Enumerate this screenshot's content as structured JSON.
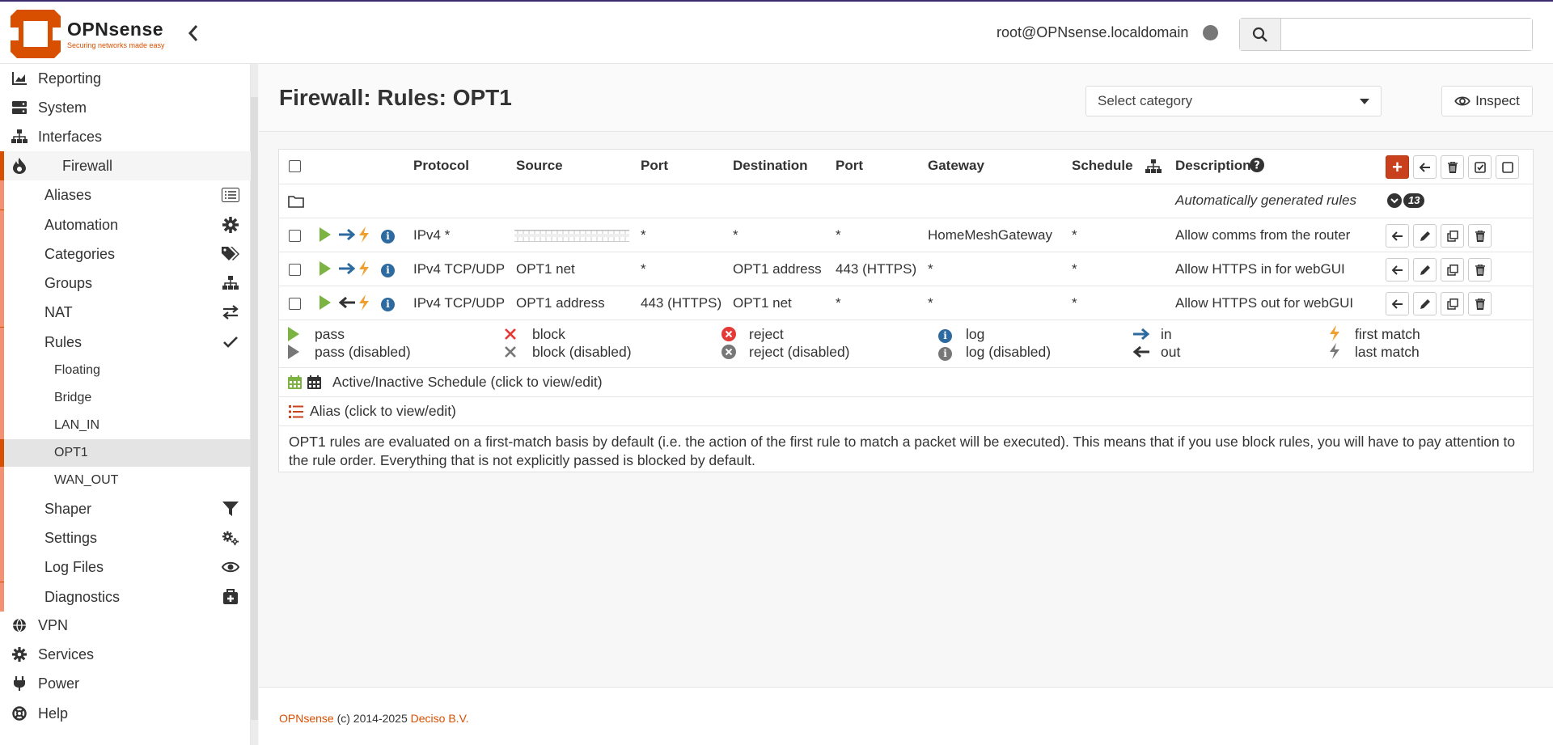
{
  "brand": {
    "name": "OPNsense",
    "tagline": "Securing networks made easy",
    "accent": "#d94f00"
  },
  "header": {
    "user": "root@OPNsense.localdomain",
    "search_placeholder": ""
  },
  "sidebar": {
    "top_items": [
      {
        "label": "Reporting",
        "icon": "chart-icon"
      },
      {
        "label": "System",
        "icon": "server-icon"
      },
      {
        "label": "Interfaces",
        "icon": "network-icon"
      },
      {
        "label": "Firewall",
        "icon": "fire-icon"
      }
    ],
    "firewall_items": [
      {
        "label": "Aliases",
        "icon": "list-icon"
      },
      {
        "label": "Automation",
        "icon": "gear-icon"
      },
      {
        "label": "Categories",
        "icon": "tags-icon"
      },
      {
        "label": "Groups",
        "icon": "sitemap-icon"
      },
      {
        "label": "NAT",
        "icon": "exchange-icon"
      },
      {
        "label": "Rules",
        "icon": "check-icon"
      }
    ],
    "rules_items": [
      "Floating",
      "Bridge",
      "LAN_IN",
      "OPT1",
      "WAN_OUT"
    ],
    "firewall_items_after": [
      {
        "label": "Shaper",
        "icon": "filter-icon"
      },
      {
        "label": "Settings",
        "icon": "gears-icon"
      },
      {
        "label": "Log Files",
        "icon": "eye-icon"
      },
      {
        "label": "Diagnostics",
        "icon": "medkit-icon"
      }
    ],
    "bottom_items": [
      {
        "label": "VPN",
        "icon": "globe-icon"
      },
      {
        "label": "Services",
        "icon": "cog-icon"
      },
      {
        "label": "Power",
        "icon": "plug-icon"
      },
      {
        "label": "Help",
        "icon": "lifering-icon"
      }
    ]
  },
  "page": {
    "title": "Firewall: Rules: OPT1",
    "category_placeholder": "Select category",
    "inspect_label": "Inspect"
  },
  "table": {
    "headers": [
      "Protocol",
      "Source",
      "Port",
      "Destination",
      "Port",
      "Gateway",
      "Schedule",
      "Description"
    ],
    "auto_rules_label": "Automatically generated rules",
    "auto_rules_count": "13",
    "rows": [
      {
        "protocol": "IPv4 *",
        "source": "",
        "source_port": "*",
        "destination": "*",
        "dest_port": "*",
        "gateway": "HomeMeshGateway",
        "schedule": "*",
        "description": "Allow comms from the router",
        "direction": "in"
      },
      {
        "protocol": "IPv4 TCP/UDP",
        "source": "OPT1 net",
        "source_port": "*",
        "destination": "OPT1 address",
        "dest_port": "443 (HTTPS)",
        "gateway": "*",
        "schedule": "*",
        "description": "Allow HTTPS in for webGUI",
        "direction": "in"
      },
      {
        "protocol": "IPv4 TCP/UDP",
        "source": "OPT1 address",
        "source_port": "443 (HTTPS)",
        "destination": "OPT1 net",
        "dest_port": "*",
        "gateway": "*",
        "schedule": "*",
        "description": "Allow HTTPS out for webGUI",
        "direction": "out"
      }
    ]
  },
  "legend": {
    "pass": "pass",
    "pass_disabled": "pass (disabled)",
    "block": "block",
    "block_disabled": "block (disabled)",
    "reject": "reject",
    "reject_disabled": "reject (disabled)",
    "log": "log",
    "log_disabled": "log (disabled)",
    "in": "in",
    "out": "out",
    "first_match": "first match",
    "last_match": "last match",
    "schedule": "Active/Inactive Schedule (click to view/edit)",
    "alias": "Alias (click to view/edit)",
    "note": "OPT1 rules are evaluated on a first-match basis by default (i.e. the action of the first rule to match a packet will be executed). This means that if you use block rules, you will have to pay attention to the rule order. Everything that is not explicitly passed is blocked by default."
  },
  "footer": {
    "product": "OPNsense",
    "copyright": " (c) 2014-2025 ",
    "company": "Deciso B.V."
  },
  "colors": {
    "pass": "#7cb342",
    "block": "#e53935",
    "reject": "#e53935",
    "direction": "#2d6a9f",
    "match": "#f0a030",
    "accent": "#d94f00"
  }
}
